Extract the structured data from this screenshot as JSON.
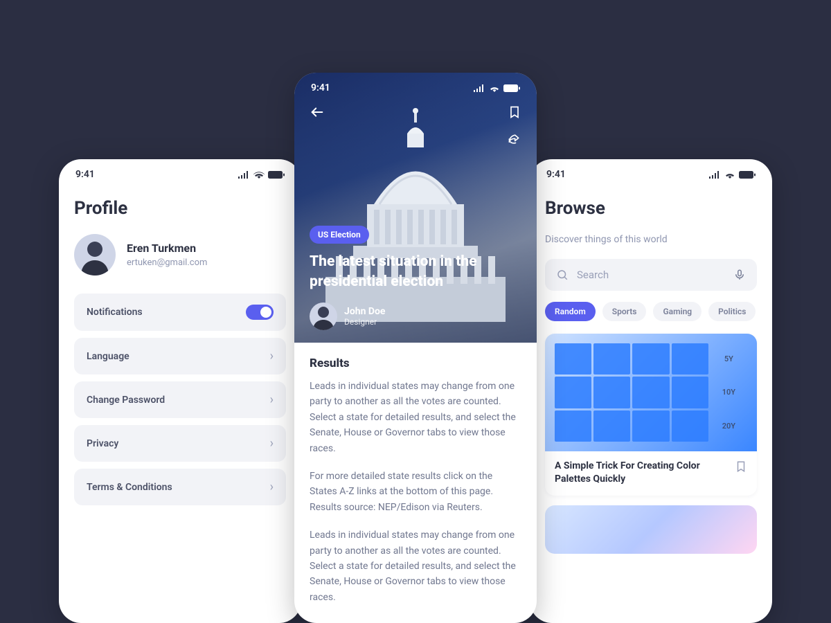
{
  "status": {
    "time": "9:41"
  },
  "colors": {
    "accent": "#5a5fef"
  },
  "profile": {
    "page_title": "Profile",
    "user": {
      "name": "Eren Turkmen",
      "email": "ertuken@gmail.com"
    },
    "items": [
      {
        "label": "Notifications",
        "type": "toggle"
      },
      {
        "label": "Language",
        "type": "link"
      },
      {
        "label": "Change Password",
        "type": "link"
      },
      {
        "label": "Privacy",
        "type": "link"
      },
      {
        "label": "Terms & Conditions",
        "type": "link"
      }
    ]
  },
  "browse": {
    "page_title": "Browse",
    "subtitle": "Discover things of this world",
    "search_placeholder": "Search",
    "chips": [
      {
        "label": "Random",
        "active": true
      },
      {
        "label": "Sports",
        "active": false
      },
      {
        "label": "Gaming",
        "active": false
      },
      {
        "label": "Politics",
        "active": false
      }
    ],
    "card": {
      "title": "A Simple Trick For Creating Color Palettes Quickly",
      "palette_labels": [
        "5Y",
        "10Y",
        "20Y"
      ]
    }
  },
  "article": {
    "tag": "US Election",
    "title": "The latest situation in the presidential election",
    "author": {
      "name": "John Doe",
      "role": "Designer"
    },
    "section_heading": "Results",
    "paragraphs": [
      "Leads in individual states may change from one party to another as all the votes are counted. Select a state for detailed results, and select the Senate, House or Governor tabs to view those races.",
      "For more detailed state results click on the States A-Z links at the bottom of this page. Results source: NEP/Edison via Reuters.",
      "Leads in individual states may change from one party to another as all the votes are counted. Select a state for detailed results, and select the Senate, House or Governor tabs to view those races."
    ]
  }
}
